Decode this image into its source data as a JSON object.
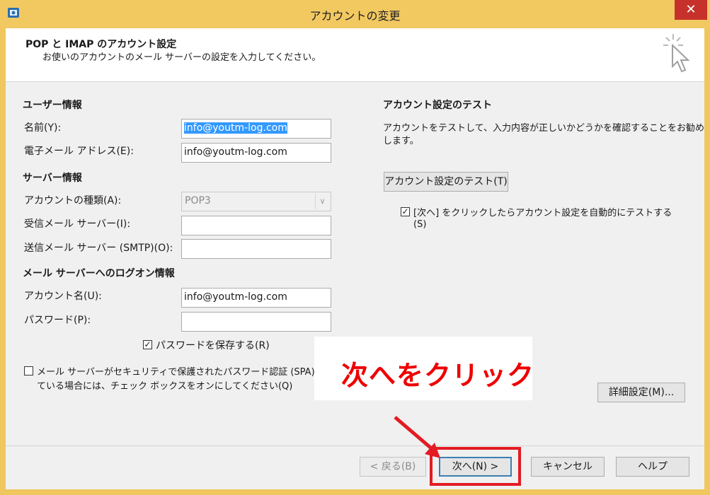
{
  "window": {
    "title": "アカウントの変更",
    "close_label": "✕"
  },
  "header": {
    "title": "POP と IMAP のアカウント設定",
    "subtitle": "お使いのアカウントのメール サーバーの設定を入力してください。"
  },
  "user_info": {
    "section_title": "ユーザー情報",
    "name_label": "名前(Y):",
    "name_value": "info@youtm-log.com",
    "email_label": "電子メール アドレス(E):",
    "email_value": "info@youtm-log.com"
  },
  "server_info": {
    "section_title": "サーバー情報",
    "account_type_label": "アカウントの種類(A):",
    "account_type_value": "POP3",
    "incoming_label": "受信メール サーバー(I):",
    "incoming_value": "",
    "outgoing_label": "送信メール サーバー (SMTP)(O):",
    "outgoing_value": ""
  },
  "logon_info": {
    "section_title": "メール サーバーへのログオン情報",
    "account_name_label": "アカウント名(U):",
    "account_name_value": "info@youtm-log.com",
    "password_label": "パスワード(P):",
    "password_value": "",
    "save_password_label": "パスワードを保存する(R)",
    "save_password_checked": true
  },
  "spa": {
    "label_line1": "メール サーバーがセキュリティで保護されたパスワード認証 (SPA) に対応し",
    "label_line2": "ている場合には、チェック ボックスをオンにしてください(Q)",
    "checked": false
  },
  "test": {
    "section_title": "アカウント設定のテスト",
    "description_line1": "アカウントをテストして、入力内容が正しいかどうかを確認することをお勧め",
    "description_line2": "します。",
    "test_button": "アカウント設定のテスト(T)",
    "auto_test_line1": "[次へ] をクリックしたらアカウント設定を自動的にテストする",
    "auto_test_line2": "(S)",
    "auto_test_checked": true
  },
  "advanced_button": "詳細設定(M)...",
  "annotation": {
    "text": "次へをクリック",
    "color": "#ee0000"
  },
  "footer": {
    "back_button": "< 戻る(B)",
    "next_button": "次へ(N) >",
    "cancel_button": "キャンセル",
    "help_button": "ヘルプ"
  },
  "colors": {
    "titlebar": "#f2c861",
    "close": "#c7312b",
    "selection": "#3399ff",
    "annotation": "#e31b23"
  }
}
